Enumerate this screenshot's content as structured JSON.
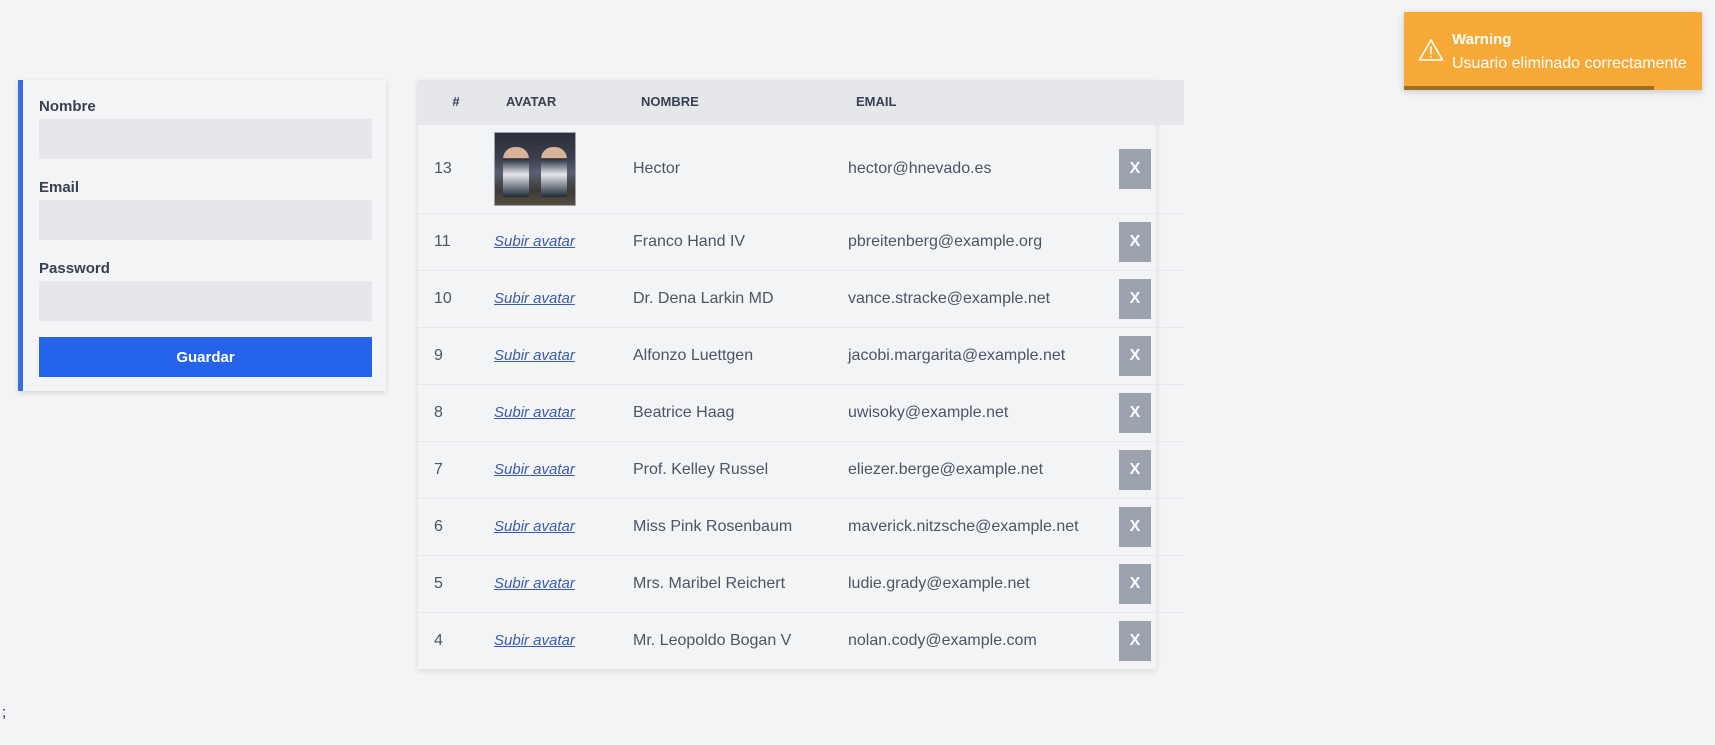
{
  "form": {
    "fields": [
      {
        "label": "Nombre",
        "value": "",
        "placeholder": ""
      },
      {
        "label": "Email",
        "value": "",
        "placeholder": ""
      },
      {
        "label": "Password",
        "value": "",
        "placeholder": ""
      }
    ],
    "submit_label": "Guardar"
  },
  "table": {
    "columns": [
      "#",
      "AVATAR",
      "NOMBRE",
      "EMAIL",
      ""
    ],
    "avatar_link_text": "Subir avatar",
    "delete_label": "X",
    "rows": [
      {
        "id": "13",
        "nombre": "Hector",
        "email": "hector@hnevado.es",
        "has_avatar": true
      },
      {
        "id": "11",
        "nombre": "Franco Hand IV",
        "email": "pbreitenberg@example.org",
        "has_avatar": false
      },
      {
        "id": "10",
        "nombre": "Dr. Dena Larkin MD",
        "email": "vance.stracke@example.net",
        "has_avatar": false
      },
      {
        "id": "9",
        "nombre": "Alfonzo Luettgen",
        "email": "jacobi.margarita@example.net",
        "has_avatar": false
      },
      {
        "id": "8",
        "nombre": "Beatrice Haag",
        "email": "uwisoky@example.net",
        "has_avatar": false
      },
      {
        "id": "7",
        "nombre": "Prof. Kelley Russel",
        "email": "eliezer.berge@example.net",
        "has_avatar": false
      },
      {
        "id": "6",
        "nombre": "Miss Pink Rosenbaum",
        "email": "maverick.nitzsche@example.net",
        "has_avatar": false
      },
      {
        "id": "5",
        "nombre": "Mrs. Maribel Reichert",
        "email": "ludie.grady@example.net",
        "has_avatar": false
      },
      {
        "id": "4",
        "nombre": "Mr. Leopoldo Bogan V",
        "email": "nolan.cody@example.com",
        "has_avatar": false
      }
    ]
  },
  "toast": {
    "title": "Warning",
    "message": "Usuario eliminado correctamente",
    "icon": "warning-triangle-icon",
    "progress": 0.84
  },
  "stray_text": ";",
  "colors": {
    "primary": "#2563eb",
    "accent_border": "#3b6fd8",
    "warning": "#f7a937",
    "delete_button": "#9ca3af",
    "link": "#3b5bab"
  }
}
